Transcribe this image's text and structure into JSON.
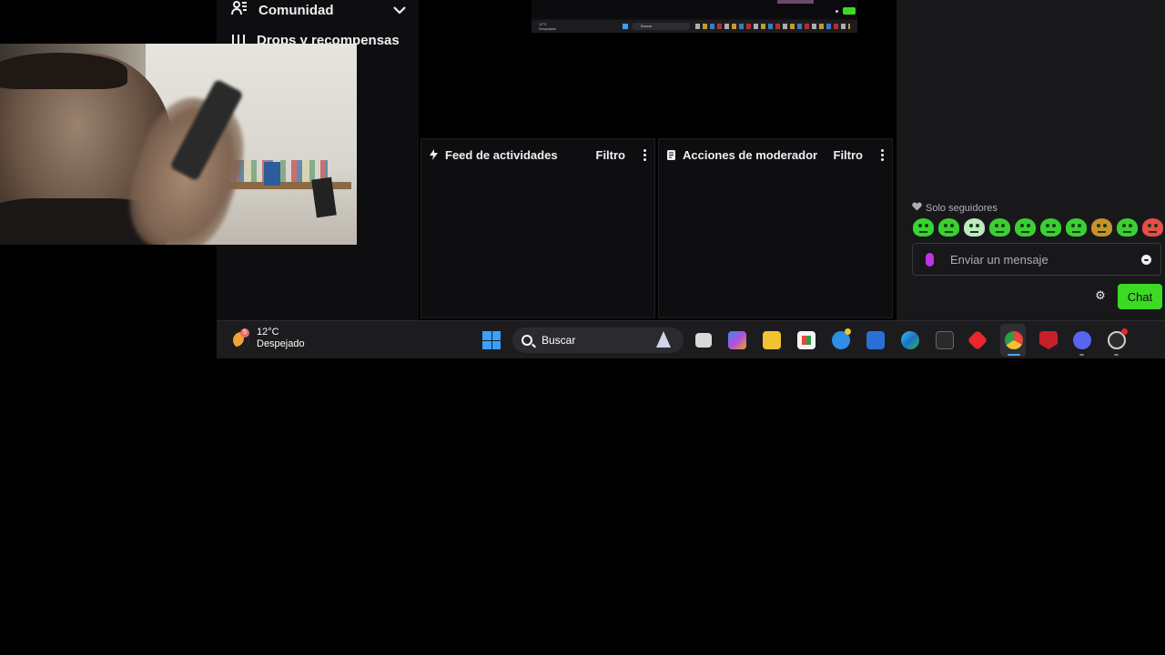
{
  "nav": {
    "comunidad": "Comunidad",
    "drops": "Drops y recompensas"
  },
  "mini_screen": {
    "weather_temp": "12°C",
    "weather_cond": "Despejado",
    "search": "Buscar",
    "chat_button": "Chat"
  },
  "panels": {
    "feed": {
      "title": "Feed de actividades",
      "filter": "Filtro"
    },
    "mod": {
      "title": "Acciones de moderador",
      "filter": "Filtro"
    }
  },
  "chat": {
    "followers_only": "Solo seguidores",
    "emote_count": 10,
    "input_placeholder": "Enviar un mensaje",
    "send_label": "Chat",
    "accent": "#3bdb23",
    "mic_color": "#bf32e6"
  },
  "taskbar": {
    "weather_badge": "5",
    "temperature": "12°C",
    "condition": "Despejado",
    "search_placeholder": "Buscar",
    "apps": [
      "task-view",
      "copilot",
      "file-explorer",
      "microsoft-store",
      "chromium-browser",
      "mail",
      "edge",
      "epic-games",
      "anydesk",
      "chrome",
      "mcafee",
      "discord",
      "obs"
    ]
  }
}
